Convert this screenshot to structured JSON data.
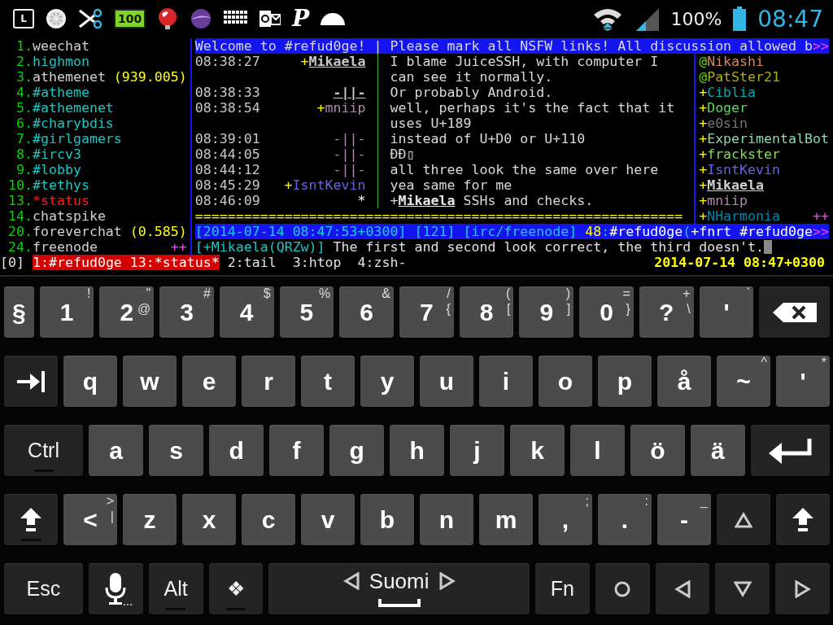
{
  "status_bar": {
    "notifications": [
      {
        "kind": "launcher",
        "text": "L"
      },
      {
        "kind": "citrus"
      },
      {
        "kind": "scissors"
      },
      {
        "kind": "battery-app",
        "text": "100"
      },
      {
        "kind": "globe"
      },
      {
        "kind": "orb"
      },
      {
        "kind": "keyboard"
      },
      {
        "kind": "mail"
      },
      {
        "kind": "letter",
        "text": "P"
      },
      {
        "kind": "dome"
      }
    ],
    "battery_percent": "100%",
    "time": "08:47"
  },
  "terminal": {
    "buffers": [
      {
        "number": "1.",
        "name": "weechat",
        "color": "#d0d0d0"
      },
      {
        "number": "2.",
        "name": "highmon",
        "color": "#19c6c6"
      },
      {
        "number": "3.",
        "name": "athemenet",
        "color": "#d0d0d0",
        "count": "(939.005)"
      },
      {
        "number": "4.",
        "name": "#atheme",
        "color": "#19c6c6"
      },
      {
        "number": "5.",
        "name": "#athemenet",
        "color": "#19c6c6"
      },
      {
        "number": "6.",
        "name": "#charybdis",
        "color": "#19c6c6"
      },
      {
        "number": "7.",
        "name": "#girlgamers",
        "color": "#19c6c6"
      },
      {
        "number": "8.",
        "name": "#ircv3",
        "color": "#19c6c6"
      },
      {
        "number": "9.",
        "name": "#lobby",
        "color": "#19c6c6"
      },
      {
        "number": "10.",
        "name": "#tethys",
        "color": "#19c6c6"
      },
      {
        "number": "13.",
        "name": "*status",
        "color": "#ff1a1a"
      },
      {
        "number": "14.",
        "name": "chatspike",
        "color": "#d0d0d0"
      },
      {
        "number": "20.",
        "name": "foreverchat",
        "color": "#d0d0d0",
        "count": "(0.585)"
      },
      {
        "number": "24.",
        "name": "freenode",
        "color": "#d0d0d0",
        "more": "++"
      }
    ],
    "title": {
      "text": "Welcome to #refud0ge! | Please mark all NSFW links! All discussion allowed b",
      "more": ">>"
    },
    "chat_lines": [
      {
        "kind": "self",
        "time": "08:38:27",
        "prefix": "+",
        "nick": "Mikaela",
        "text": "I blame JuiceSSH, with computer I"
      },
      {
        "kind": "wrap",
        "text": "can see it normally."
      },
      {
        "kind": "self",
        "time": "08:38:33",
        "nick": "-||-",
        "text": "Or probably Android."
      },
      {
        "kind": "other",
        "time": "08:38:54",
        "prefix": "+",
        "nick": "mniip",
        "color": "#b088b0",
        "text": "well, perhaps it's the fact that it"
      },
      {
        "kind": "wrap",
        "text": "uses U+189"
      },
      {
        "kind": "other",
        "time": "08:39:01",
        "nick": "-||-",
        "color": "#b088b0",
        "text": "instead of U+D0 or U+110"
      },
      {
        "kind": "other",
        "time": "08:44:05",
        "nick": "-||-",
        "color": "#b088b0",
        "text": "ĐÐ▯"
      },
      {
        "kind": "other",
        "time": "08:44:12",
        "nick": "-||-",
        "color": "#b088b0",
        "text": "all three look the same over here"
      },
      {
        "kind": "other",
        "time": "08:45:29",
        "prefix": "+",
        "nick": "IsntKevin",
        "color": "#6464e0",
        "text": "yea same for me"
      },
      {
        "kind": "action",
        "time": "08:46:09",
        "nick": "*",
        "text": "+**Mikaela** SSHs and checks."
      }
    ],
    "read_marker": "============================================================",
    "nicklist": {
      "nicks": [
        {
          "kind": "op",
          "prefix": "@",
          "nick": "Nikashi",
          "color": "#d7875f",
          "highlight": false
        },
        {
          "kind": "op",
          "prefix": "@",
          "nick": "PatSter21",
          "color": "#afaf00",
          "highlight": false
        },
        {
          "kind": "voice",
          "prefix": "+",
          "nick": "Ciblia",
          "color": "#00afaf",
          "highlight": false
        },
        {
          "kind": "voice",
          "prefix": "+",
          "nick": "Doger",
          "color": "#5fd75f",
          "highlight": false
        },
        {
          "kind": "voice",
          "prefix": "+",
          "nick": "e0sin",
          "color": "#767676",
          "highlight": false
        },
        {
          "kind": "voice",
          "prefix": "+",
          "nick": "ExperimentalBot",
          "color": "#87d7af",
          "highlight": false
        },
        {
          "kind": "voice",
          "prefix": "+",
          "nick": "frackster",
          "color": "#87d75f",
          "highlight": false
        },
        {
          "kind": "voice",
          "prefix": "+",
          "nick": "IsntKevin",
          "color": "#6464e0",
          "highlight": false
        },
        {
          "kind": "voice",
          "prefix": "+",
          "nick": "Mikaela",
          "color": "#d0d0d0",
          "highlight": true
        },
        {
          "kind": "voice",
          "prefix": "+",
          "nick": "mniip",
          "color": "#af87af",
          "highlight": false
        },
        {
          "kind": "voice",
          "prefix": "+",
          "nick": "NHarmonia",
          "color": "#0087af",
          "highlight": false,
          "more": "++"
        }
      ]
    },
    "status_line": {
      "items": [
        {
          "segments": [
            {
              "kind": "info",
              "text": "[2014-07-14 08:47:53+0300]"
            }
          ]
        },
        {
          "segments": [
            {
              "kind": "info",
              "text": "[121]"
            }
          ]
        },
        {
          "segments": [
            {
              "kind": "info",
              "text": "[irc/freenode]"
            }
          ]
        },
        {
          "segments": [
            {
              "kind": "number",
              "text": "48"
            },
            {
              "kind": "punct",
              "text": ":"
            },
            {
              "kind": "name",
              "text": "#refud0ge"
            },
            {
              "kind": "punct",
              "text": "("
            },
            {
              "kind": "name",
              "text": "+fnrt"
            }
          ]
        },
        {
          "segments": [
            {
              "kind": "name",
              "text": "#refud0ge"
            }
          ]
        }
      ],
      "more": ">>"
    },
    "input": {
      "prompt": "[+Mikaela(QRZw)]",
      "value": "The first and second look correct, the third doesn't."
    },
    "tmux": {
      "session": "[0]",
      "windows": [
        {
          "label": "1:#refud0ge 13:*status*",
          "selected": true
        },
        {
          "label": "2:tail",
          "selected": false
        },
        {
          "label": "3:htop",
          "selected": false
        },
        {
          "label": "4:zsh-",
          "selected": false
        }
      ],
      "clock": "2014-07-14 08:47+0300"
    }
  },
  "keyboard": {
    "rows": [
      {
        "keys": [
          {
            "kind": "narrow",
            "label": "§",
            "sticky": false
          },
          {
            "kind": "char",
            "label": "1",
            "upper": "!",
            "sticky": false
          },
          {
            "kind": "char",
            "label": "2",
            "upper": "\"",
            "lower": "@",
            "sticky": false
          },
          {
            "kind": "char",
            "label": "3",
            "upper": "#",
            "sticky": false
          },
          {
            "kind": "char",
            "label": "4",
            "upper": "$",
            "sticky": false
          },
          {
            "kind": "char",
            "label": "5",
            "upper": "%",
            "sticky": false
          },
          {
            "kind": "char",
            "label": "6",
            "upper": "&",
            "sticky": false
          },
          {
            "kind": "char",
            "label": "7",
            "upper": "/",
            "lower": "{",
            "sticky": false
          },
          {
            "kind": "char",
            "label": "8",
            "upper": "(",
            "lower": "[",
            "sticky": false
          },
          {
            "kind": "char",
            "label": "9",
            "upper": ")",
            "lower": "]",
            "sticky": false
          },
          {
            "kind": "char",
            "label": "0",
            "upper": "=",
            "lower": "}",
            "sticky": false
          },
          {
            "kind": "char",
            "label": "?",
            "upper": "+",
            "lower": "\\",
            "sticky": false
          },
          {
            "kind": "char",
            "label": "'",
            "upper": "`",
            "sticky": false
          },
          {
            "kind": "backspace",
            "sticky": false
          }
        ]
      },
      {
        "keys": [
          {
            "kind": "tab",
            "sticky": false
          },
          {
            "kind": "char",
            "label": "q",
            "sticky": false
          },
          {
            "kind": "char",
            "label": "w",
            "sticky": false
          },
          {
            "kind": "char",
            "label": "e",
            "sticky": false
          },
          {
            "kind": "char",
            "label": "r",
            "sticky": false
          },
          {
            "kind": "char",
            "label": "t",
            "sticky": false
          },
          {
            "kind": "char",
            "label": "y",
            "sticky": false
          },
          {
            "kind": "char",
            "label": "u",
            "sticky": false
          },
          {
            "kind": "char",
            "label": "i",
            "sticky": false
          },
          {
            "kind": "char",
            "label": "o",
            "sticky": false
          },
          {
            "kind": "char",
            "label": "p",
            "sticky": false
          },
          {
            "kind": "char",
            "label": "å",
            "sticky": false
          },
          {
            "kind": "char",
            "label": "~",
            "upper": "^",
            "sticky": false
          },
          {
            "kind": "char",
            "label": "'",
            "upper": "*",
            "sticky": false
          }
        ]
      },
      {
        "keys": [
          {
            "kind": "wide",
            "label": "Ctrl",
            "sticky": true
          },
          {
            "kind": "char",
            "label": "a",
            "sticky": false
          },
          {
            "kind": "char",
            "label": "s",
            "sticky": false
          },
          {
            "kind": "char",
            "label": "d",
            "sticky": false
          },
          {
            "kind": "char",
            "label": "f",
            "sticky": false
          },
          {
            "kind": "char",
            "label": "g",
            "sticky": false
          },
          {
            "kind": "char",
            "label": "h",
            "sticky": false
          },
          {
            "kind": "char",
            "label": "j",
            "sticky": false
          },
          {
            "kind": "char",
            "label": "k",
            "sticky": false
          },
          {
            "kind": "char",
            "label": "l",
            "sticky": false
          },
          {
            "kind": "char",
            "label": "ö",
            "sticky": false
          },
          {
            "kind": "char",
            "label": "ä",
            "sticky": false
          },
          {
            "kind": "enter",
            "sticky": false
          }
        ]
      },
      {
        "keys": [
          {
            "kind": "shift",
            "sticky": true
          },
          {
            "kind": "char",
            "label": "<",
            "upper": ">",
            "lower": "|",
            "sticky": false
          },
          {
            "kind": "char",
            "label": "z",
            "sticky": false
          },
          {
            "kind": "char",
            "label": "x",
            "sticky": false
          },
          {
            "kind": "char",
            "label": "c",
            "sticky": false
          },
          {
            "kind": "char",
            "label": "v",
            "sticky": false
          },
          {
            "kind": "char",
            "label": "b",
            "sticky": false
          },
          {
            "kind": "char",
            "label": "n",
            "sticky": false
          },
          {
            "kind": "char",
            "label": "m",
            "sticky": false
          },
          {
            "kind": "char",
            "label": ",",
            "upper": ";",
            "sticky": false
          },
          {
            "kind": "char",
            "label": ".",
            "upper": ":",
            "sticky": false
          },
          {
            "kind": "char",
            "label": "-",
            "upper": "_",
            "sticky": false
          },
          {
            "kind": "up",
            "sticky": false
          },
          {
            "kind": "shift",
            "sticky": false
          }
        ]
      },
      {
        "keys": [
          {
            "kind": "wide",
            "label": "Esc",
            "sticky": false
          },
          {
            "kind": "mic",
            "sticky": false
          },
          {
            "kind": "mod",
            "label": "Alt",
            "sticky": true
          },
          {
            "kind": "mod",
            "label": "❖",
            "sticky": true
          },
          {
            "kind": "space",
            "label": "Suomi",
            "sticky": false
          },
          {
            "kind": "mod",
            "label": "Fn",
            "sticky": false
          },
          {
            "kind": "circle",
            "sticky": false
          },
          {
            "kind": "left",
            "sticky": false
          },
          {
            "kind": "down",
            "sticky": false
          },
          {
            "kind": "right",
            "sticky": false
          }
        ]
      }
    ]
  }
}
